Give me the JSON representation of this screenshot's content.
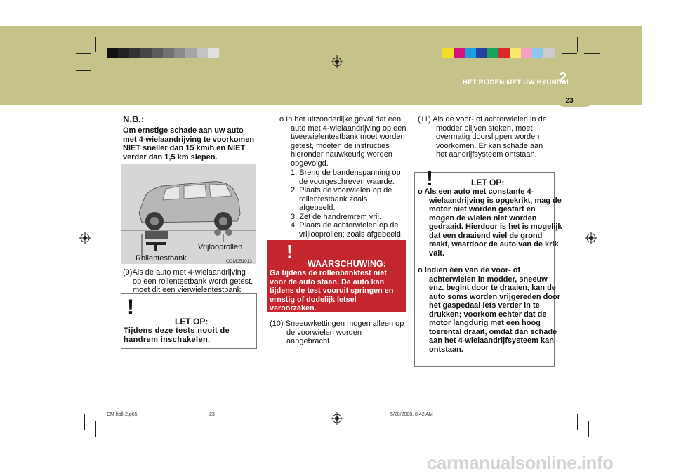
{
  "header": {
    "chapter_number": "2",
    "section_title": "HET RIJDEN MET UW HYUNDAI",
    "page_number": "23"
  },
  "color_bars": {
    "left": [
      "#111111",
      "#222222",
      "#333333",
      "#474747",
      "#5c5c5c",
      "#717171",
      "#8a8a8a",
      "#a5a5a5",
      "#c3c3c3",
      "#e0e0e0"
    ],
    "right": [
      "#f0e024",
      "#d6147b",
      "#1aa0dc",
      "#2b3fa0",
      "#1ea15a",
      "#d82828",
      "#f4e96a",
      "#f4a0c4",
      "#8cc8ec",
      "#cccccc"
    ]
  },
  "col1": {
    "note_heading": "N.B.:",
    "note_text": "Om ernstige schade aan uw auto met 4-wielaandrijving te voorkomen NIET sneller dan 15 km/h en NIET verder dan 1,5 km slepen.",
    "figure": {
      "label_rollers_free": "Vrijlooprollen",
      "label_test_bench": "Rollentestbank",
      "figure_code": "OCM051013"
    },
    "item9": "(9)Als de auto met 4-wielaandrijving op een rollentestbank wordt getest, moet dit een vierwielentestbank zijn.",
    "caution": {
      "title": "LET OP:",
      "text": "Tijdens deze tests nooit de handrem inschakelen."
    }
  },
  "col2": {
    "intro": "o In het uitzonderlijke geval dat een auto met 4-wielaandrijving op een tweewielentestbank moet worden getest, moeten de instructies hieronder nauwkeurig worden opgevolgd.",
    "steps": [
      "1. Breng de bandenspanning op de voorgeschreven waarde.",
      "2. Plaats de voorwielen op de rollentestbank zoals afgebeeld.",
      "3. Zet de handremrem vrij.",
      "4. Plaats de achterwielen op de vrijlooprollen; zoals afgebeeld."
    ],
    "warning": {
      "title": "WAARSCHUWING:",
      "text": "Ga tijdens de rollenbanktest niet voor de auto staan. De auto kan tijdens de test vooruit springen en ernstig of dodelijk letsel veroorzaken."
    },
    "item10": "(10) Sneeuwkettingen mogen alleen op de voorwielen worden aangebracht."
  },
  "col3": {
    "item11": "(11) Als de voor- of achterwielen in de modder blijven steken, moet overmatig doorslippen worden voorkomen. Er kan schade aan het aandrijfsysteem ontstaan.",
    "caution": {
      "title": "LET OP:",
      "bullet1": "o Als een auto met constante 4-wielaandrijving is opgekrikt, mag de motor niet worden gestart en mogen de wielen niet worden gedraaid. Hierdoor is het is mogelijk dat een draaiend wiel de grond raakt, waardoor de auto van de krik valt.",
      "bullet2": "o Indien één van de voor- of achterwielen in modder, sneeuw enz. begint door te draaien, kan de auto soms worden vrijgereden door het gaspedaal iets verder in te drukken; voorkom echter dat de motor langdurig met een hoog toerental draait, omdat dan schade aan het 4-wielaandrijfsysteem kan ontstaan."
    }
  },
  "footer": {
    "file": "CM holl-2.p65",
    "page": "23",
    "timestamp": "5/20/2008, 8:42 AM"
  },
  "watermark": "carmanualsonline.info"
}
